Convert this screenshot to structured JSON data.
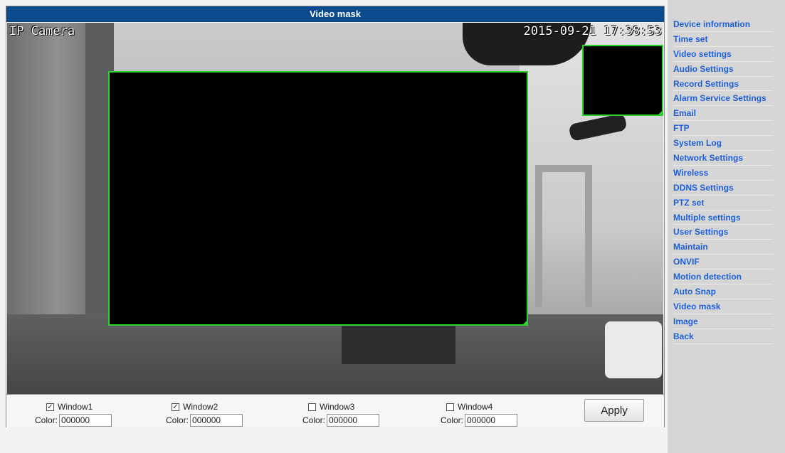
{
  "page": {
    "title": "Video mask"
  },
  "video": {
    "osd_name": "IP Camera",
    "osd_time": "2015-09-21 17:38:53"
  },
  "windows": [
    {
      "label": "Window1",
      "checked": true,
      "color_label": "Color:",
      "color_value": "000000"
    },
    {
      "label": "Window2",
      "checked": true,
      "color_label": "Color:",
      "color_value": "000000"
    },
    {
      "label": "Window3",
      "checked": false,
      "color_label": "Color:",
      "color_value": "000000"
    },
    {
      "label": "Window4",
      "checked": false,
      "color_label": "Color:",
      "color_value": "000000"
    }
  ],
  "apply_label": "Apply",
  "nav": [
    "Device information",
    "Time set",
    "Video settings",
    "Audio Settings",
    "Record Settings",
    "Alarm Service Settings",
    "Email",
    "FTP",
    "System Log",
    "Network Settings",
    "Wireless",
    "DDNS Settings",
    "PTZ set",
    "Multiple settings",
    "User Settings",
    "Maintain",
    "ONVIF",
    "Motion detection",
    "Auto Snap",
    "Video mask",
    "Image",
    "Back"
  ],
  "colors": {
    "title_bar": "#0b4a8c",
    "mask_border": "#2bd42b",
    "nav_link": "#1e5fd8"
  },
  "icons": {
    "checked": "✓"
  }
}
